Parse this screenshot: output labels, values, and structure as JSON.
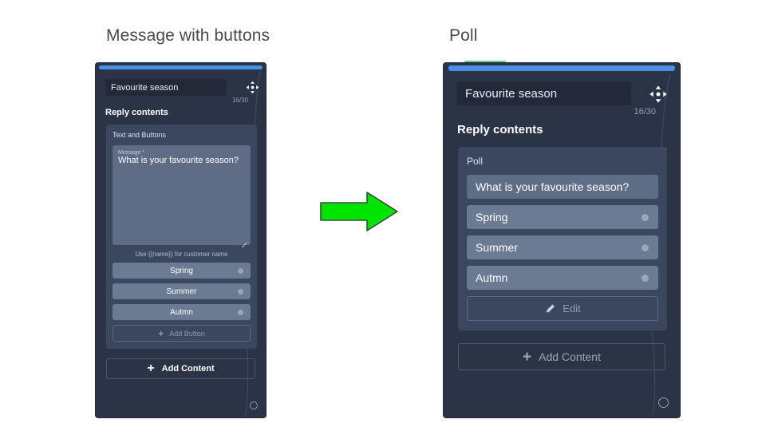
{
  "captions": {
    "left": "Message with buttons",
    "right": "Poll"
  },
  "colors": {
    "page_background": "#ffffff",
    "panel_background": "#2b3446",
    "card_background": "#3b475e",
    "topbar_blue": "#4a90e2",
    "accent_green": "#6ecb8f",
    "arrow_green": "#00e500",
    "option_button": "#6b7b93",
    "textarea_background": "#5e6c85",
    "title_input_background": "#222a3a"
  },
  "left_panel": {
    "title_value": "Favourite season",
    "title_placeholder": "Favourite season",
    "char_count": "16/30",
    "section_label": "Reply contents",
    "move_icon": "move-four-arrows-icon",
    "card": {
      "title": "Text and Buttons",
      "message_label": "Message *",
      "message_value": "What is your favourite season?",
      "hint": "Use {{name}} for customer name",
      "options": [
        {
          "label": "Spring",
          "dot": "option-dot-icon"
        },
        {
          "label": "Summer",
          "dot": "option-dot-icon"
        },
        {
          "label": "Autmn",
          "dot": "option-dot-icon"
        }
      ],
      "add_button_label": "Add Button",
      "add_button_icon": "plus-icon"
    },
    "add_content_label": "Add Content",
    "add_content_icon": "plus-icon",
    "corner_handle": "resize-circle-icon"
  },
  "right_panel": {
    "title_value": "Favourite season",
    "title_placeholder": "Favourite season",
    "char_count": "16/30",
    "section_label": "Reply contents",
    "move_icon": "move-four-arrows-icon",
    "card": {
      "title": "Poll",
      "question": "What is your favourite season?",
      "options": [
        {
          "label": "Spring",
          "dot": "option-dot-icon"
        },
        {
          "label": "Summer",
          "dot": "option-dot-icon"
        },
        {
          "label": "Autmn",
          "dot": "option-dot-icon"
        }
      ],
      "edit_label": "Edit",
      "edit_icon": "pencil-icon"
    },
    "add_content_label": "Add Content",
    "add_content_icon": "plus-icon",
    "corner_handle": "resize-circle-icon"
  },
  "arrow": {
    "icon": "right-arrow-icon",
    "direction": "right"
  },
  "glyphs": {
    "plus": "+"
  }
}
